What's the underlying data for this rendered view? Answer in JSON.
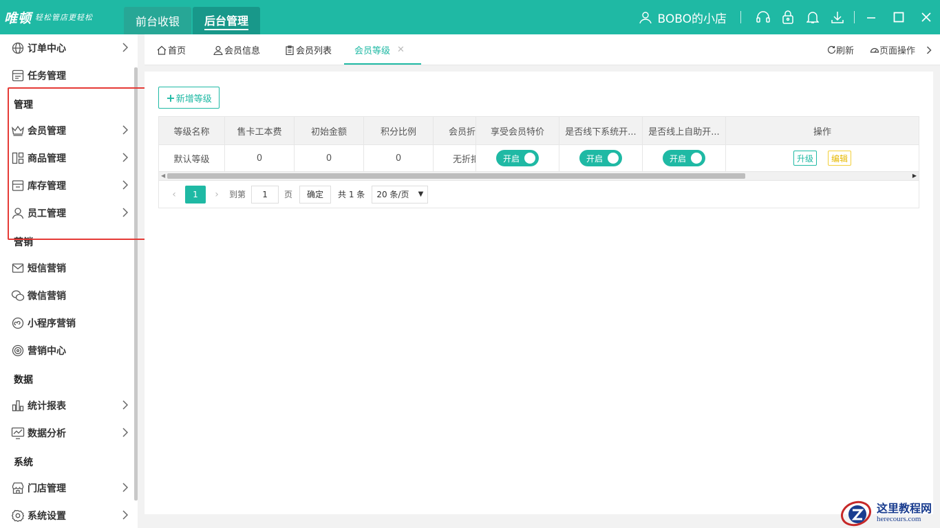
{
  "brand": {
    "logo_main": "唯顿",
    "logo_sub": "轻松管店更轻松"
  },
  "top_nav": {
    "tabs": [
      "前台收银",
      "后台管理"
    ],
    "active": "后台管理"
  },
  "header": {
    "store_name": "BOBO的小店"
  },
  "colors": {
    "accent": "#1fb9a4",
    "highlight_box": "#e53935"
  },
  "sidebar": {
    "items_top": [
      {
        "label": "订单中心",
        "icon": "globe-icon",
        "has_arrow": true
      },
      {
        "label": "任务管理",
        "icon": "task-icon",
        "has_arrow": false
      }
    ],
    "sections": [
      {
        "title": "管理",
        "items": [
          {
            "label": "会员管理",
            "icon": "crown-icon",
            "has_arrow": true
          },
          {
            "label": "商品管理",
            "icon": "grid-icon",
            "has_arrow": true
          },
          {
            "label": "库存管理",
            "icon": "inventory-icon",
            "has_arrow": true
          },
          {
            "label": "员工管理",
            "icon": "user-icon",
            "has_arrow": true
          }
        ]
      },
      {
        "title": "营销",
        "items": [
          {
            "label": "短信营销",
            "icon": "mail-icon",
            "has_arrow": false
          },
          {
            "label": "微信营销",
            "icon": "wechat-icon",
            "has_arrow": false
          },
          {
            "label": "小程序营销",
            "icon": "mini-program-icon",
            "has_arrow": false
          },
          {
            "label": "营销中心",
            "icon": "target-icon",
            "has_arrow": false
          }
        ]
      },
      {
        "title": "数据",
        "items": [
          {
            "label": "统计报表",
            "icon": "bar-chart-icon",
            "has_arrow": true
          },
          {
            "label": "数据分析",
            "icon": "trend-icon",
            "has_arrow": true
          }
        ]
      },
      {
        "title": "系统",
        "items": [
          {
            "label": "门店管理",
            "icon": "store-icon",
            "has_arrow": true
          },
          {
            "label": "系统设置",
            "icon": "gear-icon",
            "has_arrow": true
          }
        ]
      }
    ]
  },
  "tabs": {
    "items": [
      {
        "label": "首页",
        "icon": "home-icon"
      },
      {
        "label": "会员信息",
        "icon": "user-icon"
      },
      {
        "label": "会员列表",
        "icon": "clipboard-icon"
      },
      {
        "label": "会员等级",
        "icon": "",
        "active": true,
        "closable": true
      }
    ],
    "refresh": "刷新",
    "page_ops": "页面操作"
  },
  "main": {
    "add_button": "新增等级",
    "table": {
      "headers": [
        "等级名称",
        "售卡工本费",
        "初始金额",
        "积分比例",
        "会员折",
        "享受会员特价",
        "是否线下系统开...",
        "是否线上自助开...",
        "操作"
      ],
      "rows": [
        {
          "name": "默认等级",
          "card_fee": "0",
          "initial_amount": "0",
          "points_ratio": "0",
          "discount": "无折扣",
          "special_price": "开启",
          "offline_open": "开启",
          "online_open": "开启",
          "actions": [
            "升级",
            "编辑"
          ]
        }
      ]
    },
    "pagination": {
      "current_page": "1",
      "goto_label": "到第",
      "goto_value": "1",
      "page_unit": "页",
      "confirm": "确定",
      "total": "共 1 条",
      "page_size": "20 条/页"
    }
  },
  "watermark": {
    "title": "这里教程网",
    "url": "herecours.com"
  }
}
